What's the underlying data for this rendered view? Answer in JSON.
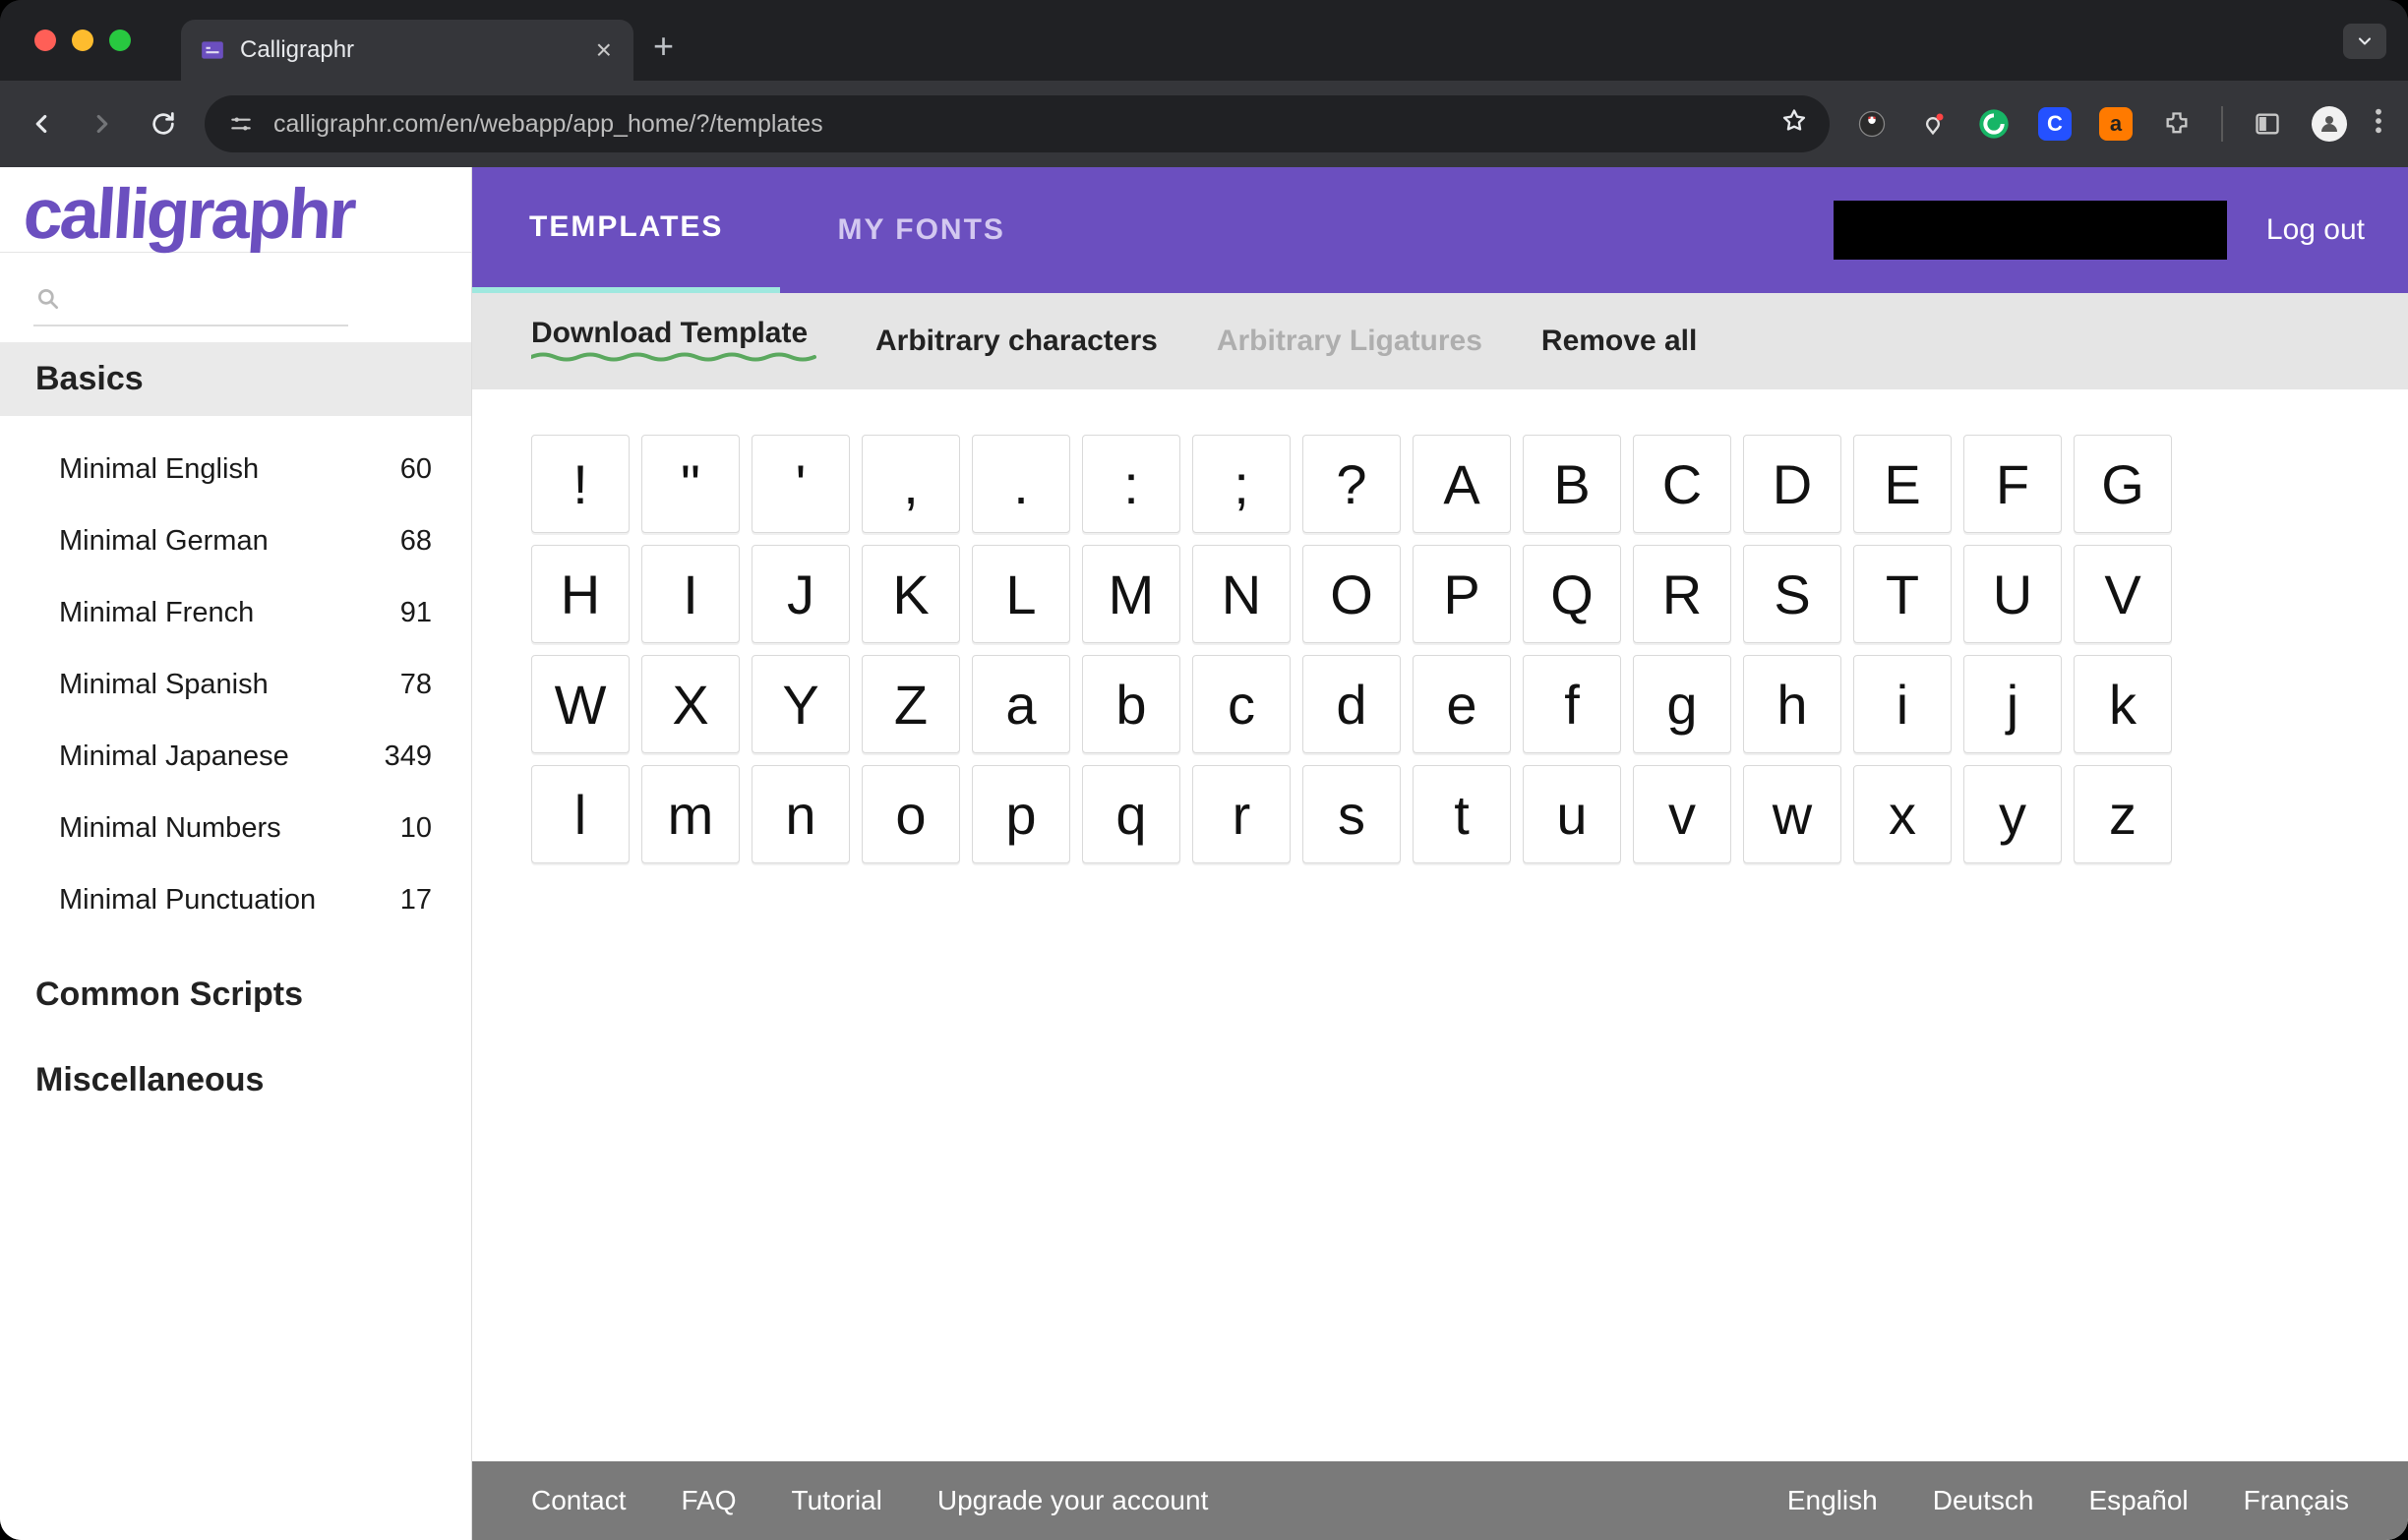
{
  "browser": {
    "tab_title": "Calligraphr",
    "url": "calligraphr.com/en/webapp/app_home/?/templates"
  },
  "header": {
    "tabs": [
      {
        "label": "TEMPLATES",
        "active": true
      },
      {
        "label": "MY FONTS",
        "active": false
      }
    ],
    "logout": "Log out"
  },
  "subbar": {
    "download": "Download Template",
    "arbitrary_chars": "Arbitrary characters",
    "arbitrary_ligatures": "Arbitrary Ligatures",
    "remove_all": "Remove all"
  },
  "sidebar": {
    "brand": "calligraphr",
    "groups": {
      "basics": {
        "title": "Basics",
        "items": [
          {
            "name": "Minimal English",
            "count": "60"
          },
          {
            "name": "Minimal German",
            "count": "68"
          },
          {
            "name": "Minimal French",
            "count": "91"
          },
          {
            "name": "Minimal Spanish",
            "count": "78"
          },
          {
            "name": "Minimal Japanese",
            "count": "349"
          },
          {
            "name": "Minimal Numbers",
            "count": "10"
          },
          {
            "name": "Minimal Punctuation",
            "count": "17"
          }
        ]
      },
      "common_scripts": {
        "title": "Common Scripts"
      },
      "miscellaneous": {
        "title": "Miscellaneous"
      }
    }
  },
  "characters": [
    "!",
    "\"",
    "'",
    ",",
    ".",
    ":",
    ";",
    "?",
    "A",
    "B",
    "C",
    "D",
    "E",
    "F",
    "G",
    "H",
    "I",
    "J",
    "K",
    "L",
    "M",
    "N",
    "O",
    "P",
    "Q",
    "R",
    "S",
    "T",
    "U",
    "V",
    "W",
    "X",
    "Y",
    "Z",
    "a",
    "b",
    "c",
    "d",
    "e",
    "f",
    "g",
    "h",
    "i",
    "j",
    "k",
    "l",
    "m",
    "n",
    "o",
    "p",
    "q",
    "r",
    "s",
    "t",
    "u",
    "v",
    "w",
    "x",
    "y",
    "z"
  ],
  "footer": {
    "links": [
      "Contact",
      "FAQ",
      "Tutorial",
      "Upgrade your account"
    ],
    "langs": [
      "English",
      "Deutsch",
      "Español",
      "Français"
    ]
  },
  "colors": {
    "brand_purple": "#6b4fbf",
    "footer_gray": "#7a7a7a"
  }
}
